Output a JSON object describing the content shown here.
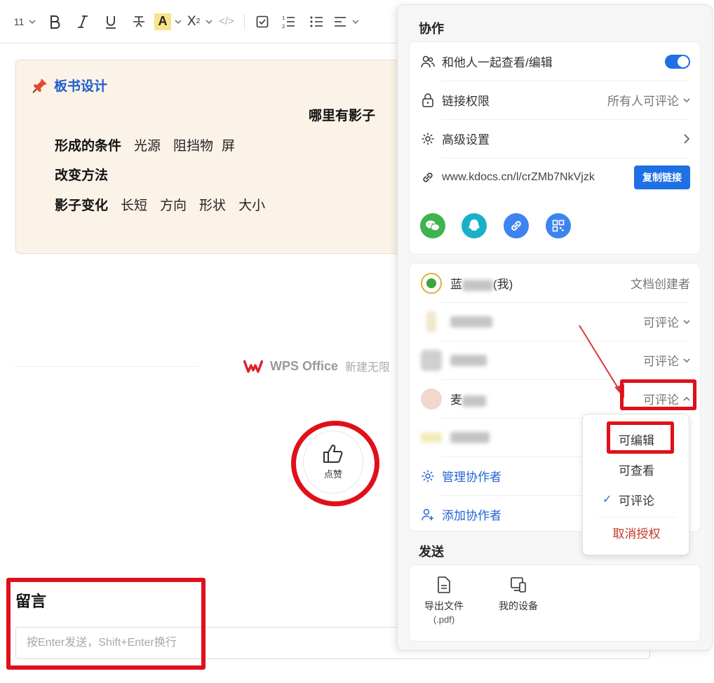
{
  "toolbar": {
    "font_size": "11",
    "buttons": [
      "bold-icon",
      "italic-icon",
      "underline-icon",
      "strikethrough-icon",
      "highlight-icon",
      "superscript-icon",
      "code-icon",
      "checkbox-icon",
      "numbered-list-icon",
      "bullet-list-icon",
      "align-icon"
    ],
    "highlight_color": "#f7e48a"
  },
  "board": {
    "title": "板书设计",
    "heading": "哪里有影子",
    "rows": [
      {
        "label": "形成的条件",
        "items": [
          "光源",
          "阻挡物",
          "屏"
        ]
      },
      {
        "label": "改变方法",
        "items": []
      },
      {
        "label": "影子变化",
        "items": [
          "长短",
          "方向",
          "形状",
          "大小"
        ]
      }
    ]
  },
  "brand": {
    "name": "WPS Office",
    "slogan": "新建无限"
  },
  "like": {
    "label": "点赞"
  },
  "comments": {
    "title": "留言",
    "placeholder": "按Enter发送，Shift+Enter换行"
  },
  "panel": {
    "collab_title": "协作",
    "together_label": "和他人一起查看/编辑",
    "together_enabled": true,
    "link_perm_label": "链接权限",
    "link_perm_value": "所有人可评论",
    "advanced_label": "高级设置",
    "url": "www.kdocs.cn/l/crZMb7NkVjzk",
    "copy_label": "复制链接",
    "share_icons": [
      {
        "name": "wechat-icon",
        "color": "#3fb34f"
      },
      {
        "name": "qq-icon",
        "color": "#1ab0c8"
      },
      {
        "name": "link-icon",
        "color": "#3d84f0"
      },
      {
        "name": "qrcode-icon",
        "color": "#3d84f0"
      }
    ],
    "members": [
      {
        "name_visible": "蓝",
        "name_suffix": "(我)",
        "role": "文档创建者"
      },
      {
        "name_visible": "",
        "name_suffix": "",
        "role": "可评论"
      },
      {
        "name_visible": "",
        "name_suffix": "",
        "role": "可评论"
      },
      {
        "name_visible": "麦",
        "name_suffix": "",
        "role": "可评论"
      },
      {
        "name_visible": "",
        "name_suffix": "",
        "role": ""
      }
    ],
    "manage_label": "管理协作者",
    "add_label": "添加协作者",
    "send_title": "发送",
    "send_items": [
      {
        "label": "导出文件",
        "sub": "(.pdf)"
      },
      {
        "label": "我的设备",
        "sub": ""
      }
    ]
  },
  "dropdown": {
    "items": [
      "可编辑",
      "可查看",
      "可评论",
      "取消授权"
    ],
    "selected": "可评论"
  }
}
